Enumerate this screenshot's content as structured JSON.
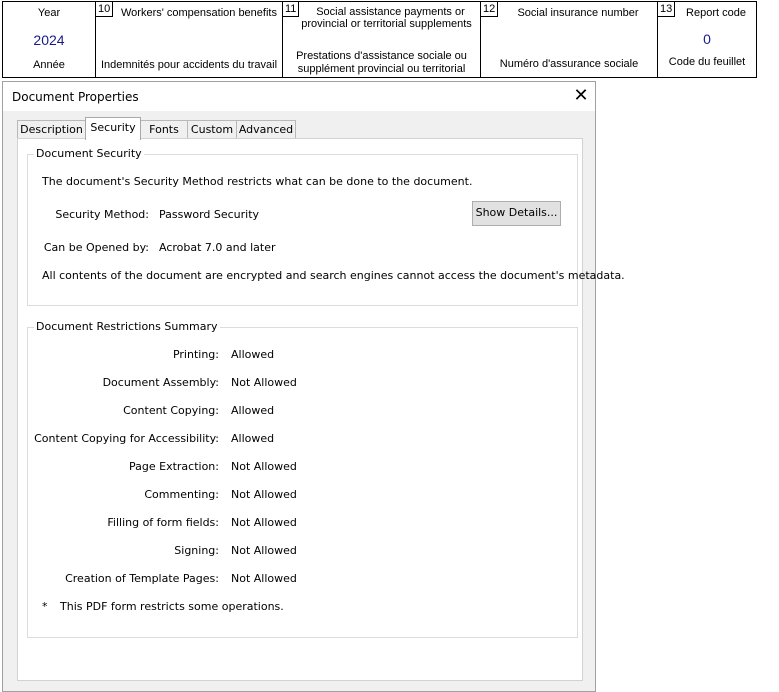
{
  "form": {
    "year": {
      "label_en": "Year",
      "value": "2024",
      "label_fr": "Année"
    },
    "box10": {
      "number": "10",
      "label_en": "Workers' compensation benefits",
      "label_fr": "Indemnités pour accidents du travail"
    },
    "box11": {
      "number": "11",
      "label_en_1": "Social assistance payments or",
      "label_en_2": "provincial or territorial supplements",
      "label_fr_1": "Prestations d'assistance sociale ou",
      "label_fr_2": "supplément provincial ou territorial"
    },
    "box12": {
      "number": "12",
      "label_en": "Social insurance number",
      "label_fr": "Numéro d'assurance sociale"
    },
    "box13": {
      "number": "13",
      "label_en": "Report code",
      "value": "0",
      "label_fr": "Code du feuillet"
    }
  },
  "dialog": {
    "title": "Document Properties",
    "close_glyph": "✕",
    "tabs": [
      "Description",
      "Security",
      "Fonts",
      "Custom",
      "Advanced"
    ],
    "active_tab": "Security",
    "security": {
      "group_label": "Document Security",
      "intro": "The document's Security Method restricts what can be done to the document.",
      "method_label": "Security Method:",
      "method_value": "Password Security",
      "show_details": "Show Details...",
      "opened_label": "Can be Opened by:",
      "opened_value": "Acrobat 7.0 and later",
      "note": "All contents of the document are encrypted and search engines cannot access the document's metadata."
    },
    "restrictions": {
      "group_label": "Document Restrictions Summary",
      "rows": [
        {
          "label": "Printing:",
          "value": "Allowed"
        },
        {
          "label": "Document Assembly:",
          "value": "Not Allowed"
        },
        {
          "label": "Content Copying:",
          "value": "Allowed"
        },
        {
          "label": "Content Copying for Accessibility:",
          "value": "Allowed"
        },
        {
          "label": "Page Extraction:",
          "value": "Not Allowed"
        },
        {
          "label": "Commenting:",
          "value": "Not Allowed"
        },
        {
          "label": "Filling of form fields:",
          "value": "Not Allowed"
        },
        {
          "label": "Signing:",
          "value": "Not Allowed"
        },
        {
          "label": "Creation of Template Pages:",
          "value": "Not Allowed"
        }
      ],
      "footnote_mark": "*",
      "footnote": "This PDF form restricts some operations."
    }
  }
}
